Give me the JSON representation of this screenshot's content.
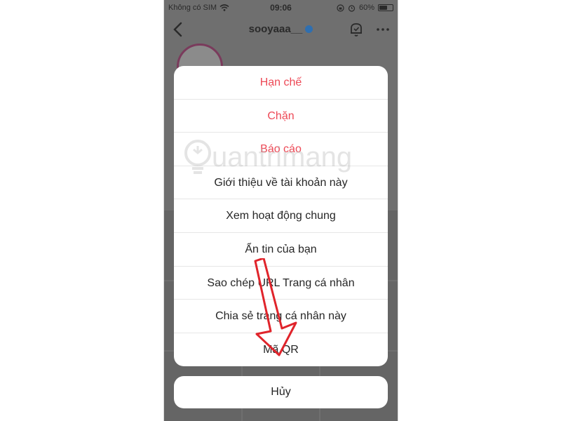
{
  "status_bar": {
    "carrier": "Không có SIM",
    "time": "09:06",
    "battery": "60%",
    "battery_level": 0.6
  },
  "profile": {
    "username": "sooyaaa__"
  },
  "action_sheet": {
    "items": [
      {
        "label": "Hạn chế",
        "destructive": true
      },
      {
        "label": "Chặn",
        "destructive": true
      },
      {
        "label": "Báo cáo",
        "destructive": true
      },
      {
        "label": "Giới thiệu về tài khoản này",
        "destructive": false
      },
      {
        "label": "Xem hoạt động chung",
        "destructive": false
      },
      {
        "label": "Ẩn tin của bạn",
        "destructive": false
      },
      {
        "label": "Sao chép URL Trang cá nhân",
        "destructive": false
      },
      {
        "label": "Chia sẻ trang cá nhân này",
        "destructive": false
      },
      {
        "label": "Mã QR",
        "destructive": false
      }
    ],
    "cancel_label": "Hủy"
  },
  "watermark": {
    "text": "uantrimang"
  },
  "colors": {
    "destructive": "#ed4956",
    "overlay": "#6f6f6f",
    "annotation_arrow": "#e0242b"
  }
}
